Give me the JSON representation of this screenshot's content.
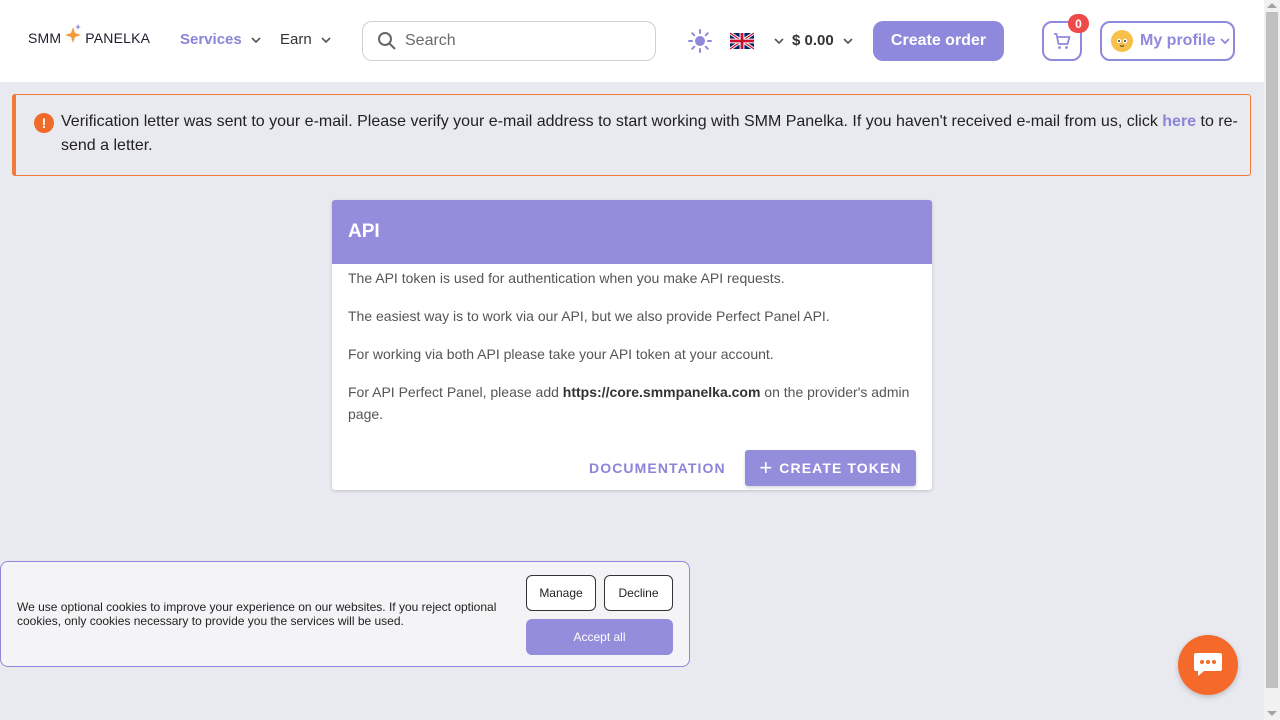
{
  "header": {
    "logo_left": "SMM",
    "logo_right": "PANELKA",
    "nav": {
      "services": "Services",
      "earn": "Earn"
    },
    "search_placeholder": "Search",
    "balance": "$ 0.00",
    "create_order": "Create order",
    "cart_count": "0",
    "profile": "My profile"
  },
  "alert": {
    "text_before": "Verification letter was sent to your e-mail. Please verify your e-mail address to start working with SMM Panelka. If you haven't received e-mail from us, click ",
    "link": "here",
    "text_after": " to re-send a letter."
  },
  "api_card": {
    "title": "API",
    "p1": "The API token is used for authentication when you make API requests.",
    "p2": "The easiest way is to work via our API, but we also provide Perfect Panel API.",
    "p3": "For working via both API please take your API token at your account.",
    "p4_before": "For API Perfect Panel, please add ",
    "p4_url": "https://core.smmpanelka.com",
    "p4_after": " on the provider's admin page.",
    "documentation": "DOCUMENTATION",
    "create_token": "CREATE TOKEN"
  },
  "cookie": {
    "text": "We use optional cookies to improve your experience on our websites. If you reject optional cookies, only cookies necessary to provide you the services will be used.",
    "manage": "Manage",
    "decline": "Decline",
    "accept": "Accept all"
  },
  "colors": {
    "accent": "#938ddc",
    "alert_orange": "#f07a3c",
    "badge_red": "#ef4a4a",
    "chat_orange": "#f56a2a"
  }
}
